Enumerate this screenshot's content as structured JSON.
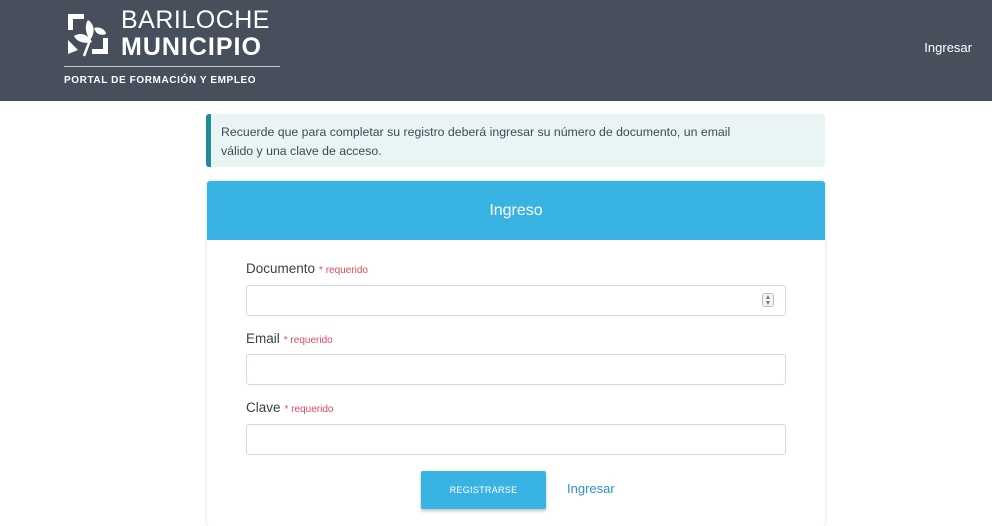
{
  "header": {
    "logo": {
      "line1": "BARILOCHE",
      "line2": "MUNICIPIO",
      "tagline": "PORTAL DE FORMACIÓN Y EMPLEO",
      "icon": "flower-icon"
    },
    "nav_login_label": "Ingresar",
    "background_color": "#474f5c"
  },
  "alert": {
    "line1": "Recuerde que para completar su registro deberá ingresar su número de documento, un email",
    "line2": "válido y una clave de acceso."
  },
  "form": {
    "title": "Ingreso",
    "accent_color": "#39b3e3",
    "fields": [
      {
        "label": "Documento",
        "required_text": "* requerido",
        "value": ""
      },
      {
        "label": "Email",
        "required_text": "* requerido",
        "value": ""
      },
      {
        "label": "Clave",
        "required_text": "* requerido",
        "value": ""
      }
    ],
    "submit_label": "REGISTRARSE",
    "login_link_label": "Ingresar"
  }
}
